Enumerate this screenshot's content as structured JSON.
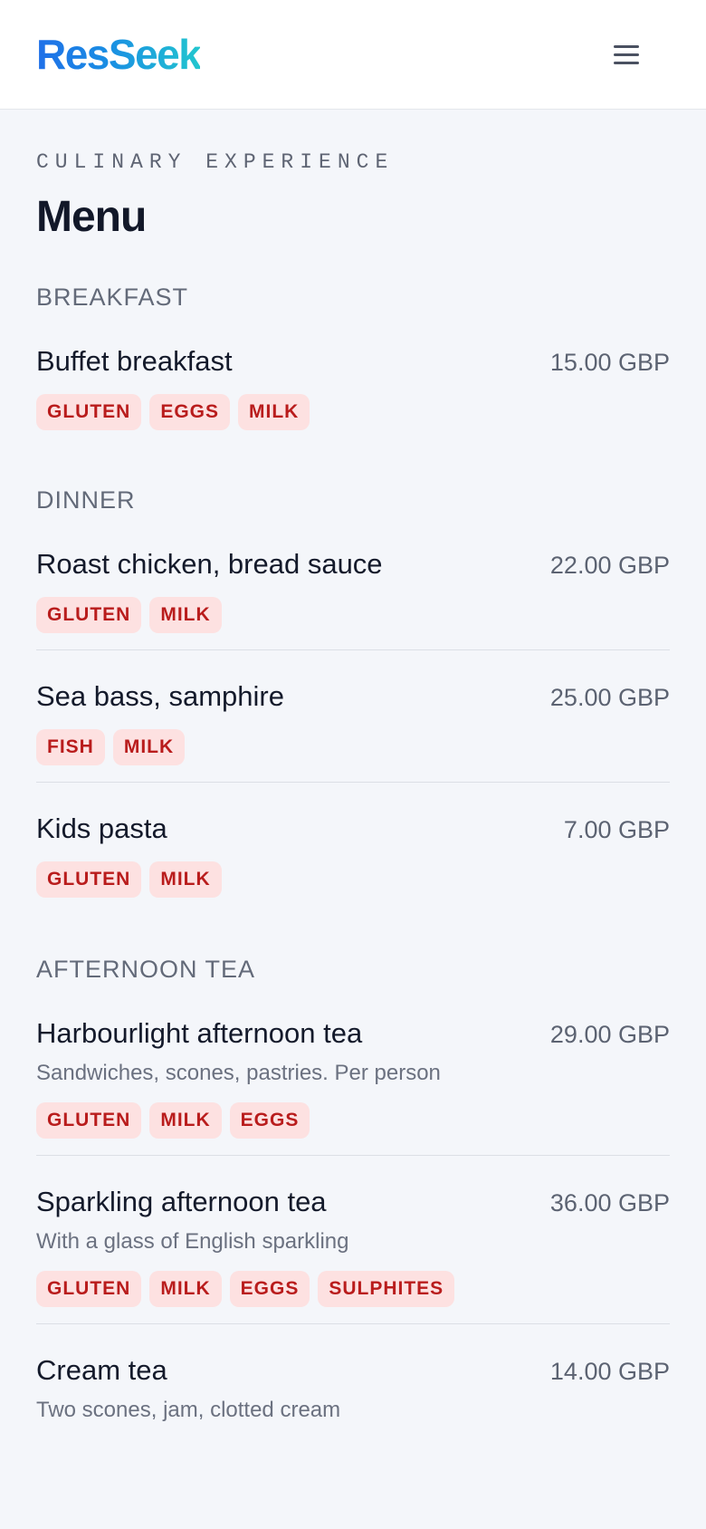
{
  "header": {
    "logo": "ResSeek",
    "menu_icon": "hamburger-menu-icon"
  },
  "page": {
    "eyebrow": "CULINARY EXPERIENCE",
    "title": "Menu"
  },
  "sections": [
    {
      "title": "BREAKFAST",
      "items": [
        {
          "name": "Buffet breakfast",
          "price": "15.00 GBP",
          "description": "",
          "tags": [
            "GLUTEN",
            "EGGS",
            "MILK"
          ]
        }
      ]
    },
    {
      "title": "DINNER",
      "items": [
        {
          "name": "Roast chicken, bread sauce",
          "price": "22.00 GBP",
          "description": "",
          "tags": [
            "GLUTEN",
            "MILK"
          ]
        },
        {
          "name": "Sea bass, samphire",
          "price": "25.00 GBP",
          "description": "",
          "tags": [
            "FISH",
            "MILK"
          ]
        },
        {
          "name": "Kids pasta",
          "price": "7.00 GBP",
          "description": "",
          "tags": [
            "GLUTEN",
            "MILK"
          ]
        }
      ]
    },
    {
      "title": "AFTERNOON TEA",
      "items": [
        {
          "name": "Harbourlight afternoon tea",
          "price": "29.00 GBP",
          "description": "Sandwiches, scones, pastries. Per person",
          "tags": [
            "GLUTEN",
            "MILK",
            "EGGS"
          ]
        },
        {
          "name": "Sparkling afternoon tea",
          "price": "36.00 GBP",
          "description": "With a glass of English sparkling",
          "tags": [
            "GLUTEN",
            "MILK",
            "EGGS",
            "SULPHITES"
          ]
        },
        {
          "name": "Cream tea",
          "price": "14.00 GBP",
          "description": "Two scones, jam, clotted cream",
          "tags": []
        }
      ]
    }
  ],
  "colors": {
    "brand_gradient_start": "#1f6fe8",
    "brand_gradient_end": "#22c6cf",
    "allergen_bg": "#fde1e1",
    "allergen_text": "#b91c1c",
    "page_bg": "#f4f6fa"
  }
}
